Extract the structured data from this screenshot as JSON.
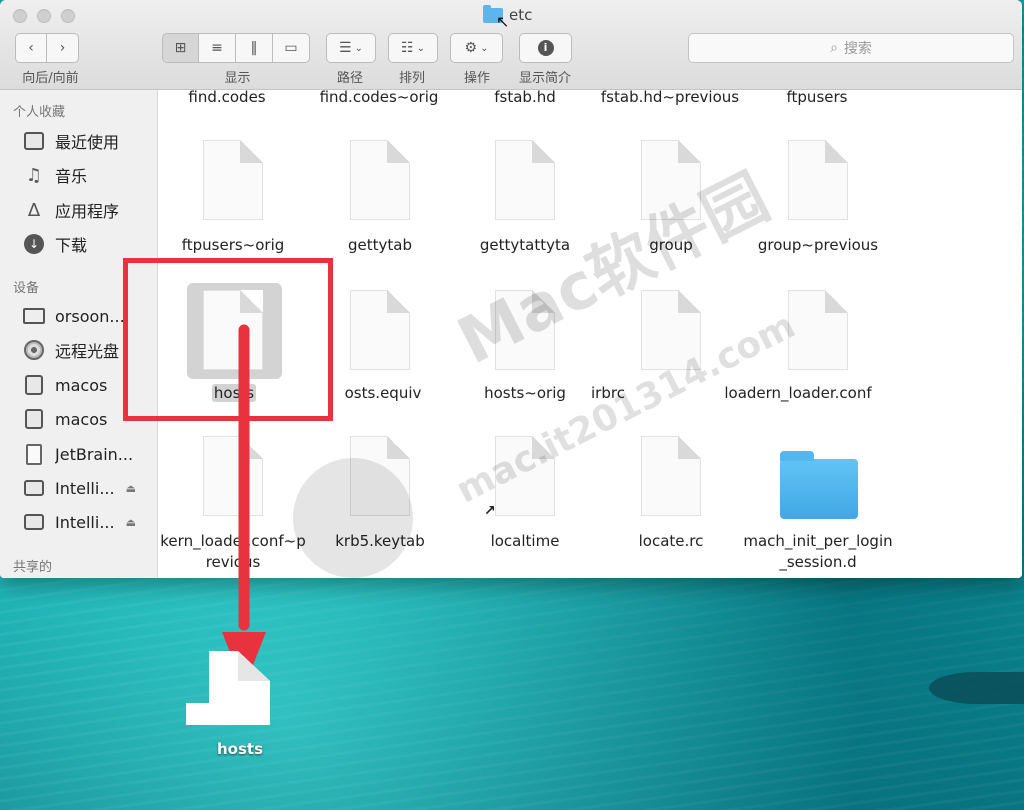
{
  "window": {
    "title": "etc"
  },
  "toolbar": {
    "nav_label": "向后/向前",
    "view_label": "显示",
    "path_label": "路径",
    "arrange_label": "排列",
    "action_label": "操作",
    "info_label": "显示简介",
    "search_placeholder": "搜索"
  },
  "sidebar": {
    "favorites_header": "个人收藏",
    "favorites": [
      "最近使用",
      "音乐",
      "应用程序",
      "下载"
    ],
    "devices_header": "设备",
    "devices": [
      "orsoon...",
      "远程光盘",
      "macos",
      "macos",
      "JetBrain...",
      "Intelli...",
      "Intelli..."
    ],
    "shared_header": "共享的"
  },
  "files": {
    "row0": [
      "find.codes",
      "find.codes~orig",
      "fstab.hd",
      "fstab.hd~previous",
      "ftpusers"
    ],
    "row1": [
      "ftpusers~orig",
      "gettytab",
      "gettytattyta",
      "group",
      "group~previous"
    ],
    "row2": [
      "hosts",
      "osts.equiv",
      "hosts~orig",
      "irbrc",
      "loadern_loader.conf"
    ],
    "row3": [
      "kern_loader.conf~previous",
      "krb5.keytab",
      "localtime",
      "locate.rc",
      "mach_init_per_login_session.d"
    ]
  },
  "desktop": {
    "dragged_file": "hosts"
  },
  "watermark": {
    "brand": "Mac软件园",
    "url": "mac.it201314.com"
  },
  "colors": {
    "highlight": "#e8323e",
    "folder": "#4fb3ec",
    "desktop": "#11a8b0"
  }
}
